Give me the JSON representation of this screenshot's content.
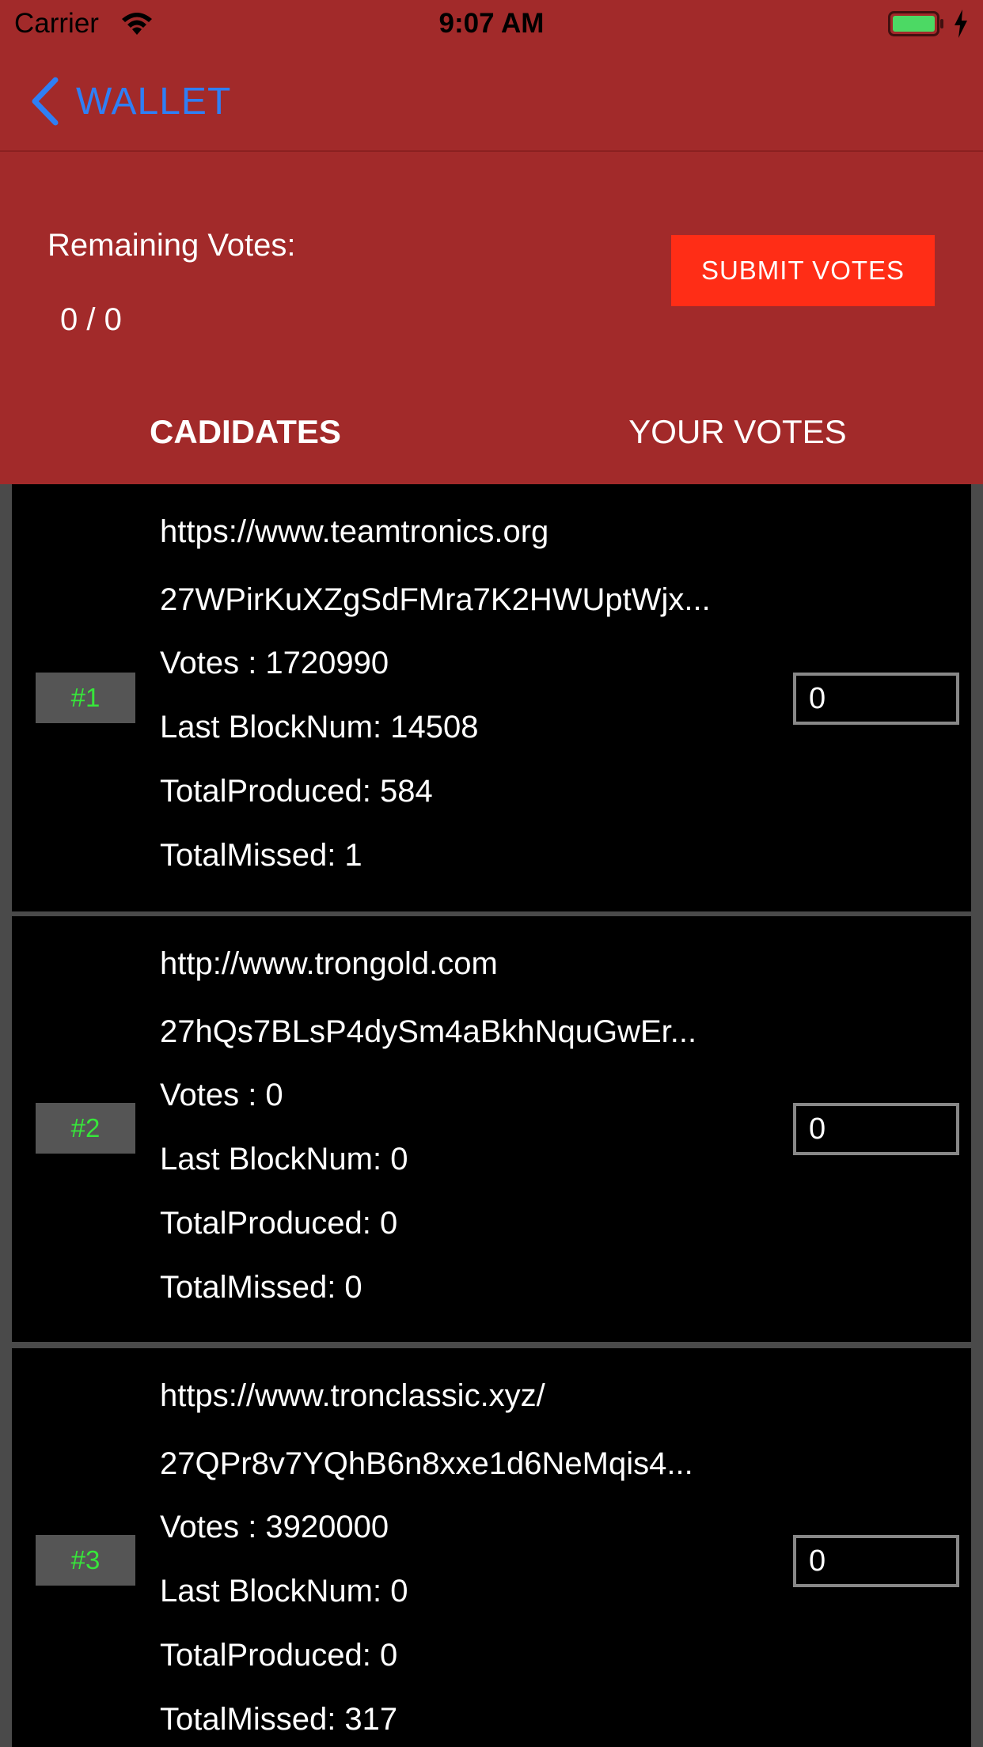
{
  "status_bar": {
    "carrier": "Carrier",
    "time": "9:07 AM"
  },
  "nav": {
    "back_label": "WALLET"
  },
  "header": {
    "remaining_label": "Remaining Votes:",
    "remaining_value": "0 / 0",
    "submit_label": "SUBMIT VOTES"
  },
  "tabs": {
    "candidates": "CADIDATES",
    "your_votes": "YOUR VOTES"
  },
  "candidates": [
    {
      "rank": "#1",
      "url": "https://www.teamtronics.org",
      "address": "27WPirKuXZgSdFMra7K2HWUptWjx...",
      "votes": "Votes :  1720990",
      "last_block": "Last BlockNum: 14508",
      "total_produced": "TotalProduced:  584",
      "total_missed": "TotalMissed: 1",
      "input_value": "0"
    },
    {
      "rank": "#2",
      "url": "http://www.trongold.com",
      "address": "27hQs7BLsP4dySm4aBkhNquGwEr...",
      "votes": "Votes :  0",
      "last_block": "Last BlockNum: 0",
      "total_produced": "TotalProduced:  0",
      "total_missed": "TotalMissed: 0",
      "input_value": "0"
    },
    {
      "rank": "#3",
      "url": "https://www.tronclassic.xyz/",
      "address": "27QPr8v7YQhB6n8xxe1d6NeMqis4...",
      "votes": "Votes :  3920000",
      "last_block": "Last BlockNum: 0",
      "total_produced": "TotalProduced:  0",
      "total_missed": "TotalMissed: 317",
      "input_value": "0"
    }
  ],
  "colors": {
    "header_red": "#a22a2a",
    "submit_red": "#ff2d16",
    "back_blue": "#2f7ff5",
    "rank_green": "#37e63a"
  }
}
